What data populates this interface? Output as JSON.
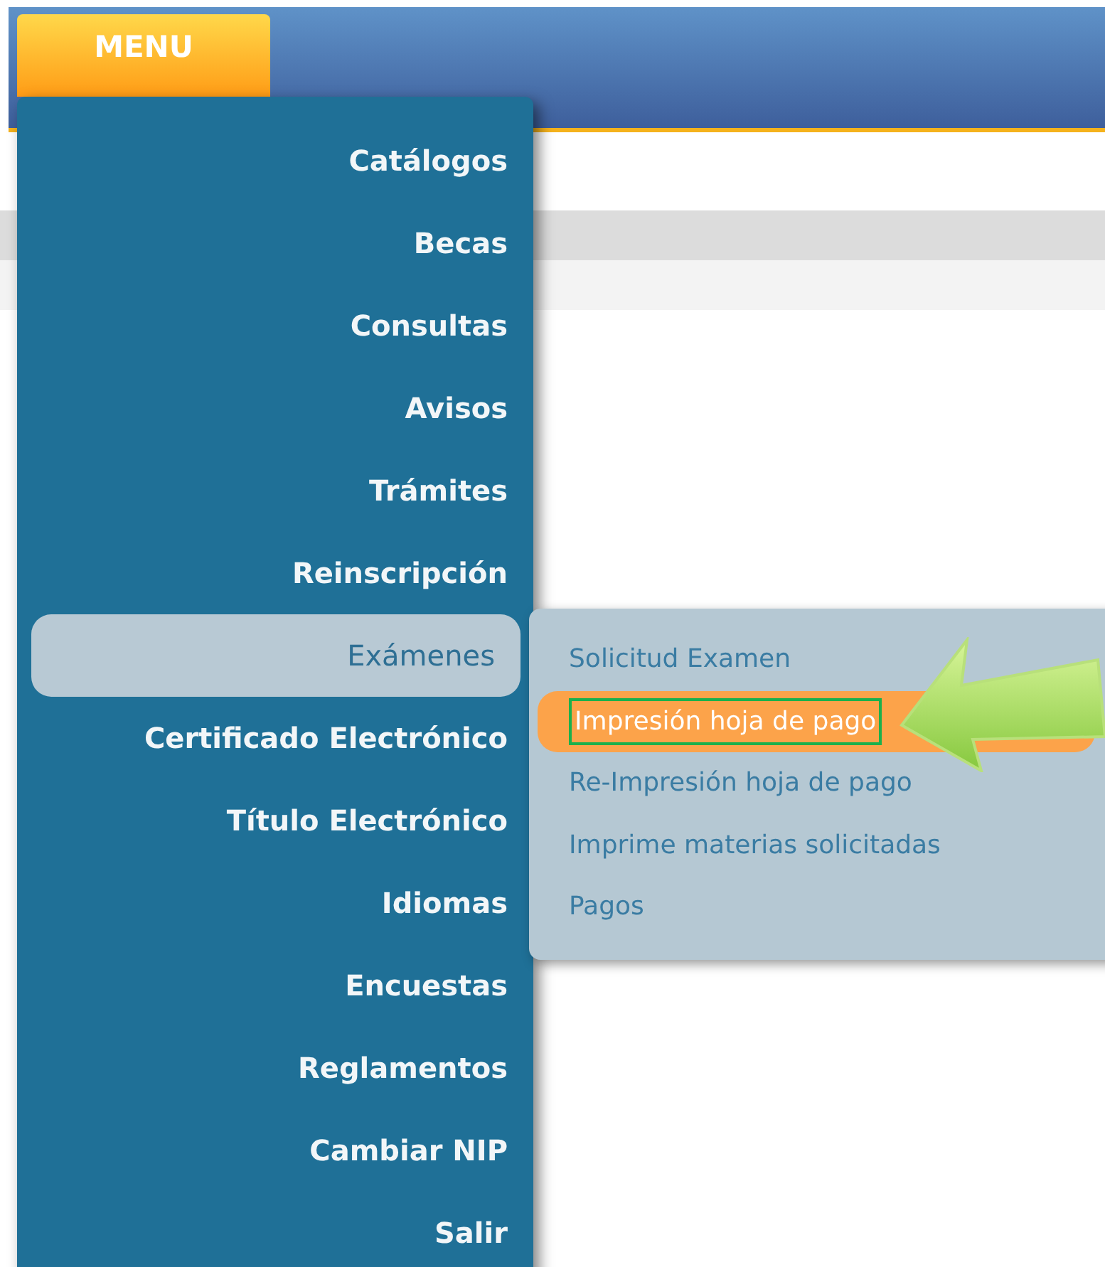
{
  "menu_button": {
    "label": "MENU"
  },
  "menu": {
    "items": [
      {
        "label": "Catálogos",
        "selected": false
      },
      {
        "label": "Becas",
        "selected": false
      },
      {
        "label": "Consultas",
        "selected": false
      },
      {
        "label": "Avisos",
        "selected": false
      },
      {
        "label": "Trámites",
        "selected": false
      },
      {
        "label": "Reinscripción",
        "selected": false
      },
      {
        "label": "Exámenes",
        "selected": true
      },
      {
        "label": "Certificado Electrónico",
        "selected": false
      },
      {
        "label": "Título Electrónico",
        "selected": false
      },
      {
        "label": "Idiomas",
        "selected": false
      },
      {
        "label": "Encuestas",
        "selected": false
      },
      {
        "label": "Reglamentos",
        "selected": false
      },
      {
        "label": "Cambiar NIP",
        "selected": false
      },
      {
        "label": "Salir",
        "selected": false
      }
    ]
  },
  "submenu": {
    "items": [
      {
        "label": "Solicitud Examen",
        "selected": false
      },
      {
        "label": "Impresión hoja de pago",
        "selected": true
      },
      {
        "label": "Re-Impresión hoja de pago",
        "selected": false
      },
      {
        "label": "Imprime materias solicitadas",
        "selected": false
      },
      {
        "label": "Pagos",
        "selected": false
      }
    ]
  }
}
